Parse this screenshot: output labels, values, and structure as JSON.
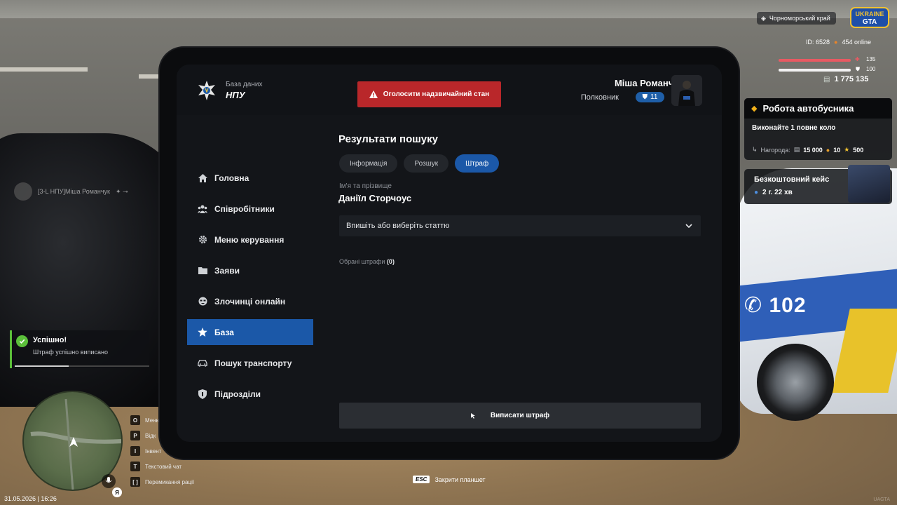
{
  "tablet": {
    "header": {
      "db_caption": "База даних",
      "db_name": "НПУ",
      "emergency_label": "Оголосити надзвичайний стан",
      "user_name": "Міша Романчук",
      "user_rank": "Полковник",
      "rank_level": "11"
    },
    "sidebar": {
      "items": [
        {
          "label": "Головна",
          "icon": "home-icon"
        },
        {
          "label": "Співробітники",
          "icon": "users-icon"
        },
        {
          "label": "Меню керування",
          "icon": "gear-icon"
        },
        {
          "label": "Заяви",
          "icon": "folder-icon"
        },
        {
          "label": "Злочинці онлайн",
          "icon": "mask-icon"
        },
        {
          "label": "База",
          "icon": "star-icon",
          "active": true
        },
        {
          "label": "Пошук транспорту",
          "icon": "car-icon"
        },
        {
          "label": "Підрозділи",
          "icon": "shield-icon"
        }
      ]
    },
    "main": {
      "title": "Результати пошуку",
      "tabs": [
        {
          "label": "Інформація",
          "active": false
        },
        {
          "label": "Розшук",
          "active": false
        },
        {
          "label": "Штраф",
          "active": true
        }
      ],
      "name_label": "Ім'я та прізвище",
      "name_value": "Даніїл Сторчоус",
      "article_placeholder": "Впишіть або виберіть статтю",
      "selected_fines_label": "Обрані штрафи",
      "selected_fines_count": "(0)",
      "submit_label": "Виписати штраф"
    }
  },
  "hud": {
    "region": "Чорноморський край",
    "brand": "UKRAINE GTA",
    "player_id": "ID: 6528",
    "online": "454 online",
    "health_value": "135",
    "armor_value": "100",
    "money": "1 775 135",
    "quest": {
      "title": "Робота автобусника",
      "task": "Виконайте 1 повне коло",
      "reward_label": "Нагорода:",
      "reward_money": "15 000",
      "reward_coins": "10",
      "reward_stars": "500"
    },
    "free_case": {
      "title": "Безкоштовний кейс",
      "timer": "2 г. 22 хв"
    },
    "nametag": "[3-L НПУ]Міша Романчук",
    "toast": {
      "title": "Успішно!",
      "text": "Штраф успішно виписано",
      "progress": 0.4
    },
    "keybinds": [
      {
        "key": "O",
        "label": "Меню"
      },
      {
        "key": "P",
        "label": "Відк"
      },
      {
        "key": "I",
        "label": "Інвент"
      },
      {
        "key": "T",
        "label": "Текстовий чат"
      },
      {
        "key": "[ ]",
        "label": "Перемикання рації"
      }
    ],
    "language": "Я",
    "datetime": "31.05.2026 | 16:26",
    "esc_key": "ESC",
    "esc_label": "Закрити планшет",
    "watermark": "UAGTA",
    "police_number": "102"
  },
  "colors": {
    "accent": "#1b58a8",
    "danger": "#b9272a",
    "success": "#5bbf3a",
    "panel": "#131519"
  }
}
